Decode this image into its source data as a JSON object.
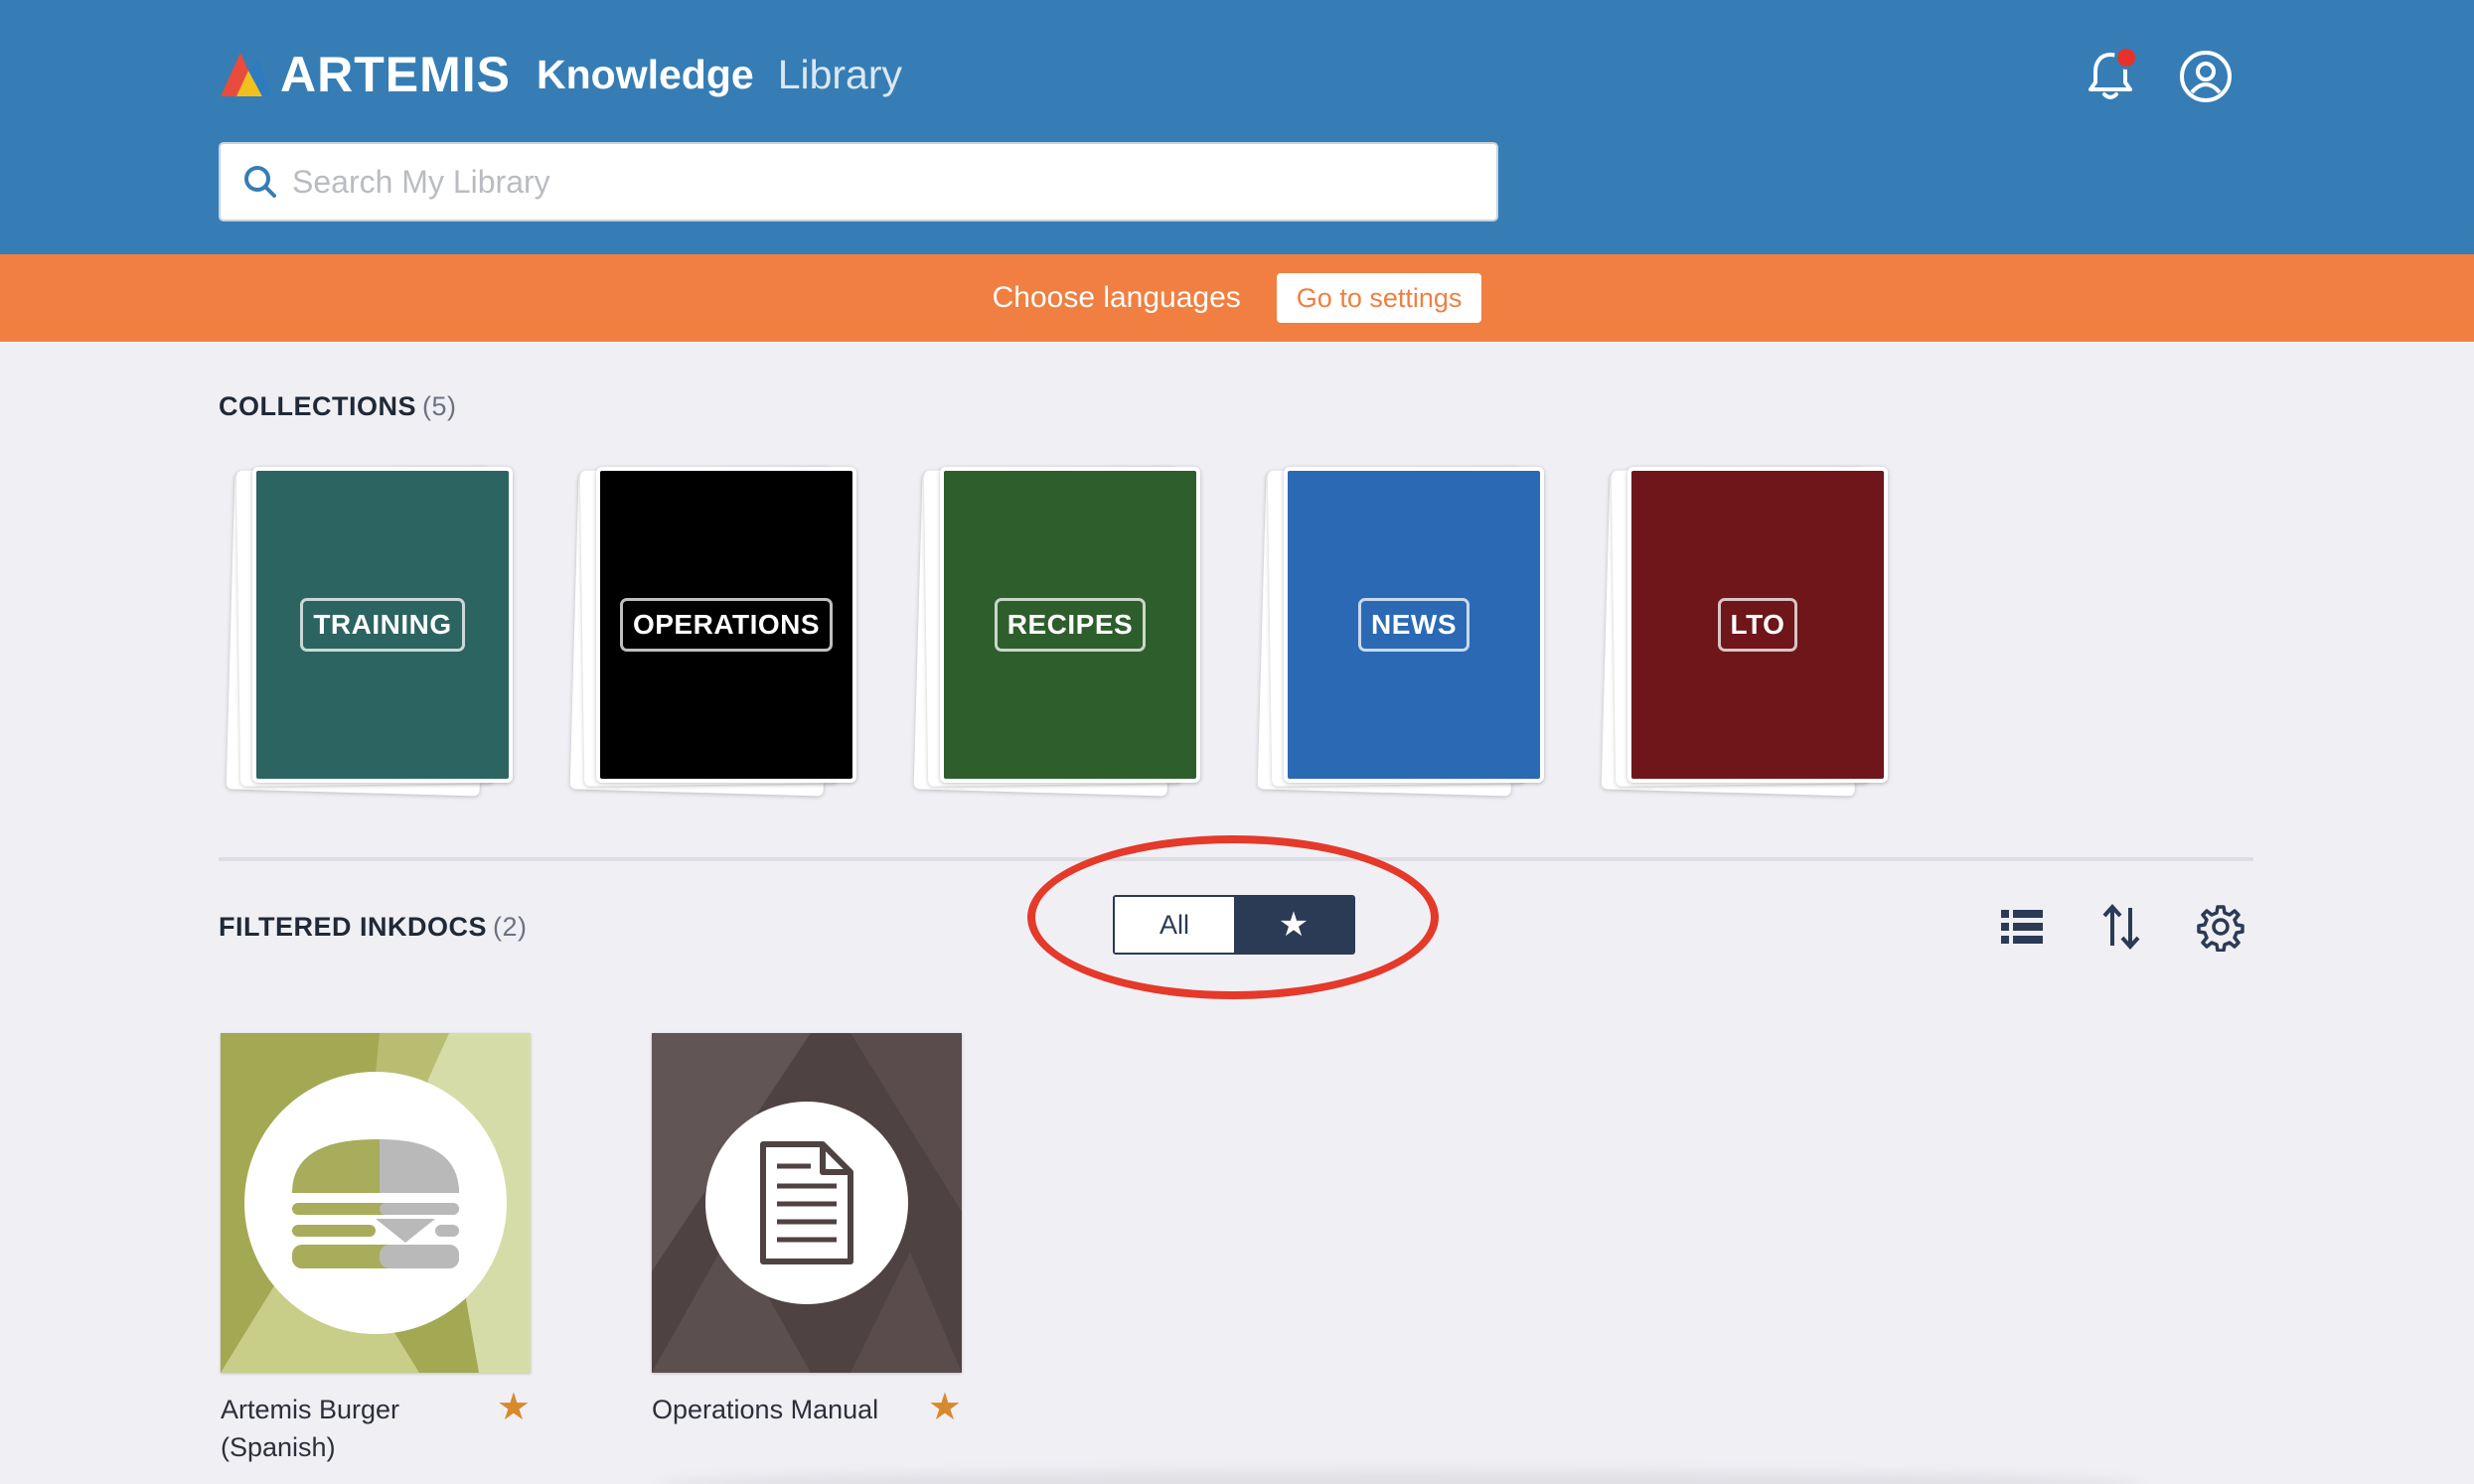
{
  "header": {
    "brand": "ARTEMIS",
    "sub1": "Knowledge",
    "sub2": "Library",
    "bell_icon": "bell-icon",
    "user_icon": "user-circle-icon",
    "colors": {
      "header_bg": "#367db5",
      "notification_dot": "#e5322b"
    }
  },
  "search": {
    "placeholder": "Search My Library"
  },
  "banner": {
    "text": "Choose languages",
    "button": "Go to settings",
    "color": "#f07f41"
  },
  "collections": {
    "title": "COLLECTIONS",
    "count": "(5)",
    "items": [
      {
        "label": "TRAINING",
        "color": "#2c6462"
      },
      {
        "label": "OPERATIONS",
        "color": "#000000"
      },
      {
        "label": "RECIPES",
        "color": "#2e5e2c"
      },
      {
        "label": "NEWS",
        "color": "#2b69b5"
      },
      {
        "label": "LTO",
        "color": "#6e1619"
      }
    ]
  },
  "filtered": {
    "title": "FILTERED INKDOCS",
    "count": "(2)",
    "toggle": {
      "all": "All",
      "starred_icon": "star-icon",
      "selected": "starred"
    },
    "tools": [
      "list-view-icon",
      "sort-icon",
      "gear-icon"
    ],
    "docs": [
      {
        "title": "Artemis Burger (Spanish)",
        "icon": "burger-icon",
        "starred": true
      },
      {
        "title": "Operations Manual",
        "icon": "document-icon",
        "starred": true
      }
    ]
  }
}
